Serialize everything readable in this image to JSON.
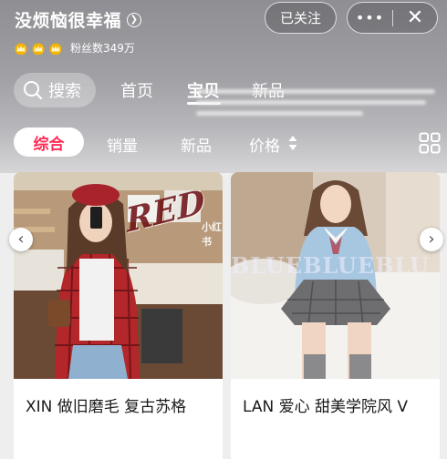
{
  "store": {
    "name": "没烦恼很幸福",
    "followers": "粉丝数349万",
    "crown_count": 3
  },
  "actions": {
    "followed_label": "已关注",
    "more_label": "•••",
    "close_label": "✕"
  },
  "search": {
    "label": "搜索"
  },
  "nav_tabs": [
    {
      "label": "首页",
      "active": false
    },
    {
      "label": "宝贝",
      "active": true
    },
    {
      "label": "新品",
      "active": false
    }
  ],
  "sort_tabs": [
    {
      "label": "综合",
      "active": true
    },
    {
      "label": "销量",
      "active": false
    },
    {
      "label": "新品",
      "active": false
    },
    {
      "label": "价格",
      "active": false
    }
  ],
  "products": [
    {
      "title": "XIN 做旧磨毛 复古苏格",
      "watermark": "RED"
    },
    {
      "title": "LAN 爱心 甜美学院风 V",
      "watermark": "BLUEBLUEBLU"
    }
  ],
  "watermark_text": "小红书",
  "icons": {
    "store_chevron": "chevron-right-circle-icon",
    "search": "search-icon",
    "price_sort": "sort-arrows-icon",
    "layout": "grid-icon",
    "carousel_prev": "chevron-left-icon",
    "carousel_next": "chevron-right-icon"
  },
  "colors": {
    "accent": "#ff2b53",
    "header_gray": "#9a9a9f"
  }
}
